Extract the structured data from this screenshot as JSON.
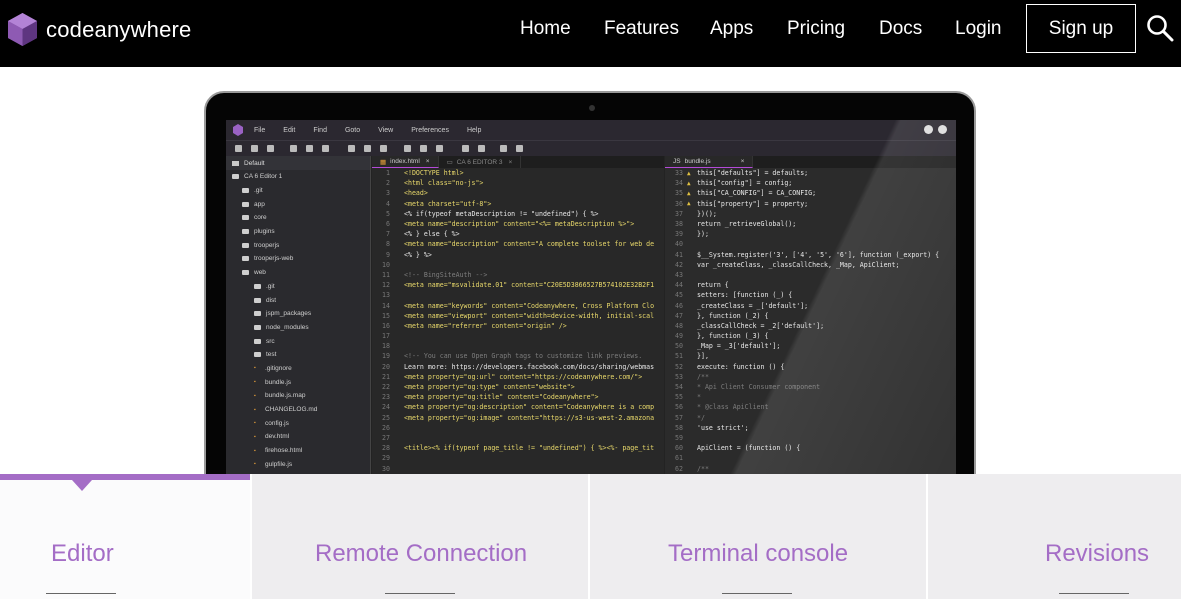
{
  "brand": {
    "name": "codeanywhere",
    "accent": "#a46dc6"
  },
  "nav": {
    "items": [
      "Home",
      "Features",
      "Apps",
      "Pricing",
      "Docs",
      "Login"
    ],
    "signup": "Sign up",
    "search_icon": "search-icon"
  },
  "ide": {
    "menus": [
      "File",
      "Edit",
      "Find",
      "Goto",
      "View",
      "Preferences",
      "Help"
    ],
    "sidebar_title": "Default",
    "tree": [
      {
        "name": "CA 6 Editor 1",
        "type": "root"
      },
      {
        "name": ".git",
        "type": "folder"
      },
      {
        "name": "app",
        "type": "folder"
      },
      {
        "name": "core",
        "type": "folder"
      },
      {
        "name": "plugins",
        "type": "folder"
      },
      {
        "name": "trooperjs",
        "type": "folder"
      },
      {
        "name": "trooperjs-web",
        "type": "folder"
      },
      {
        "name": "web",
        "type": "folder"
      },
      {
        "name": ".git",
        "type": "subfolder"
      },
      {
        "name": "dist",
        "type": "subfolder"
      },
      {
        "name": "jspm_packages",
        "type": "subfolder"
      },
      {
        "name": "node_modules",
        "type": "subfolder"
      },
      {
        "name": "src",
        "type": "subfolder"
      },
      {
        "name": "test",
        "type": "subfolder"
      },
      {
        "name": ".gitignore",
        "type": "file"
      },
      {
        "name": "bundle.js",
        "type": "file"
      },
      {
        "name": "bundle.js.map",
        "type": "file"
      },
      {
        "name": "CHANGELOG.md",
        "type": "file"
      },
      {
        "name": "config.js",
        "type": "file"
      },
      {
        "name": "dev.html",
        "type": "file"
      },
      {
        "name": "firehose.html",
        "type": "file"
      },
      {
        "name": "gulpfile.js",
        "type": "file"
      }
    ],
    "left_tabs": [
      "index.html",
      "CA 6 EDITOR 3"
    ],
    "right_tab": "bundle.js",
    "left_code": [
      {
        "n": "1",
        "t": "<!DOCTYPE html>"
      },
      {
        "n": "2",
        "t": "<html class=\"no-js\">"
      },
      {
        "n": "3",
        "t": "  <head>"
      },
      {
        "n": "4",
        "t": "    <meta charset=\"utf-8\">"
      },
      {
        "n": "5",
        "t": "    <% if(typeof metaDescription != \"undefined\") { %>"
      },
      {
        "n": "6",
        "t": "    <meta name=\"description\" content=\"<%= metaDescription %>\">"
      },
      {
        "n": "7",
        "t": "    <% } else { %>"
      },
      {
        "n": "8",
        "t": "    <meta name=\"description\" content=\"A complete toolset for web de"
      },
      {
        "n": "9",
        "t": "    <% } %>"
      },
      {
        "n": "10",
        "t": ""
      },
      {
        "n": "11",
        "t": "    <!-- BingSiteAuth -->"
      },
      {
        "n": "12",
        "t": "    <meta name=\"msvalidate.01\" content=\"C20E5D3866527B574102E32B2F1"
      },
      {
        "n": "13",
        "t": ""
      },
      {
        "n": "14",
        "t": "    <meta name=\"keywords\" content=\"Codeanywhere, Cross Platform Clo"
      },
      {
        "n": "15",
        "t": "    <meta name=\"viewport\" content=\"width=device-width, initial-scal"
      },
      {
        "n": "16",
        "t": "    <meta name=\"referrer\" content=\"origin\" />"
      },
      {
        "n": "17",
        "t": ""
      },
      {
        "n": "18",
        "t": ""
      },
      {
        "n": "19",
        "t": "    <!-- You can use Open Graph tags to customize link previews."
      },
      {
        "n": "20",
        "t": "    Learn more: https://developers.facebook.com/docs/sharing/webmas"
      },
      {
        "n": "21",
        "t": "    <meta property=\"og:url\" content=\"https://codeanywhere.com/\">"
      },
      {
        "n": "22",
        "t": "    <meta property=\"og:type\" content=\"website\">"
      },
      {
        "n": "23",
        "t": "    <meta property=\"og:title\" content=\"Codeanywhere\">"
      },
      {
        "n": "24",
        "t": "    <meta property=\"og:description\" content=\"Codeanywhere is a comp"
      },
      {
        "n": "25",
        "t": "    <meta property=\"og:image\" content=\"https://s3-us-west-2.amazona"
      },
      {
        "n": "26",
        "t": ""
      },
      {
        "n": "27",
        "t": ""
      },
      {
        "n": "28",
        "t": "    <title><% if(typeof page_title != \"undefined\") { %><%- page_tit"
      },
      {
        "n": "29",
        "t": ""
      },
      {
        "n": "30",
        "t": ""
      }
    ],
    "right_code": [
      {
        "n": "33",
        "t": "      this[\"defaults\"] = defaults;"
      },
      {
        "n": "34",
        "t": "      this[\"config\"] = config;"
      },
      {
        "n": "35",
        "t": "      this[\"CA_CONFIG\"] = CA_CONFIG;"
      },
      {
        "n": "36",
        "t": "      this[\"property\"] = property;"
      },
      {
        "n": "37",
        "t": "    })();"
      },
      {
        "n": "38",
        "t": "    return _retrieveGlobal();"
      },
      {
        "n": "39",
        "t": "  });"
      },
      {
        "n": "40",
        "t": ""
      },
      {
        "n": "41",
        "t": "  $__System.register('3', ['4', '5', '6'], function (_export) {"
      },
      {
        "n": "42",
        "t": "    var _createClass, _classCallCheck, _Map, ApiClient;"
      },
      {
        "n": "43",
        "t": ""
      },
      {
        "n": "44",
        "t": "    return {"
      },
      {
        "n": "45",
        "t": "      setters: [function (_) {"
      },
      {
        "n": "46",
        "t": "        _createClass = _['default'];"
      },
      {
        "n": "47",
        "t": "      }, function (_2) {"
      },
      {
        "n": "48",
        "t": "        _classCallCheck = _2['default'];"
      },
      {
        "n": "49",
        "t": "      }, function (_3) {"
      },
      {
        "n": "50",
        "t": "        _Map = _3['default'];"
      },
      {
        "n": "51",
        "t": "      }],"
      },
      {
        "n": "52",
        "t": "      execute: function () {"
      },
      {
        "n": "53",
        "t": "        /**"
      },
      {
        "n": "54",
        "t": "         * Api Client Consumer component"
      },
      {
        "n": "55",
        "t": "         *"
      },
      {
        "n": "56",
        "t": "         * @class ApiClient"
      },
      {
        "n": "57",
        "t": "         */"
      },
      {
        "n": "58",
        "t": "        'use strict';"
      },
      {
        "n": "59",
        "t": ""
      },
      {
        "n": "60",
        "t": "        ApiClient = (function () {"
      },
      {
        "n": "61",
        "t": ""
      },
      {
        "n": "62",
        "t": "          /**"
      }
    ]
  },
  "features": {
    "tabs": [
      "Editor",
      "Remote Connection",
      "Terminal console",
      "Revisions"
    ],
    "active": "Editor"
  }
}
